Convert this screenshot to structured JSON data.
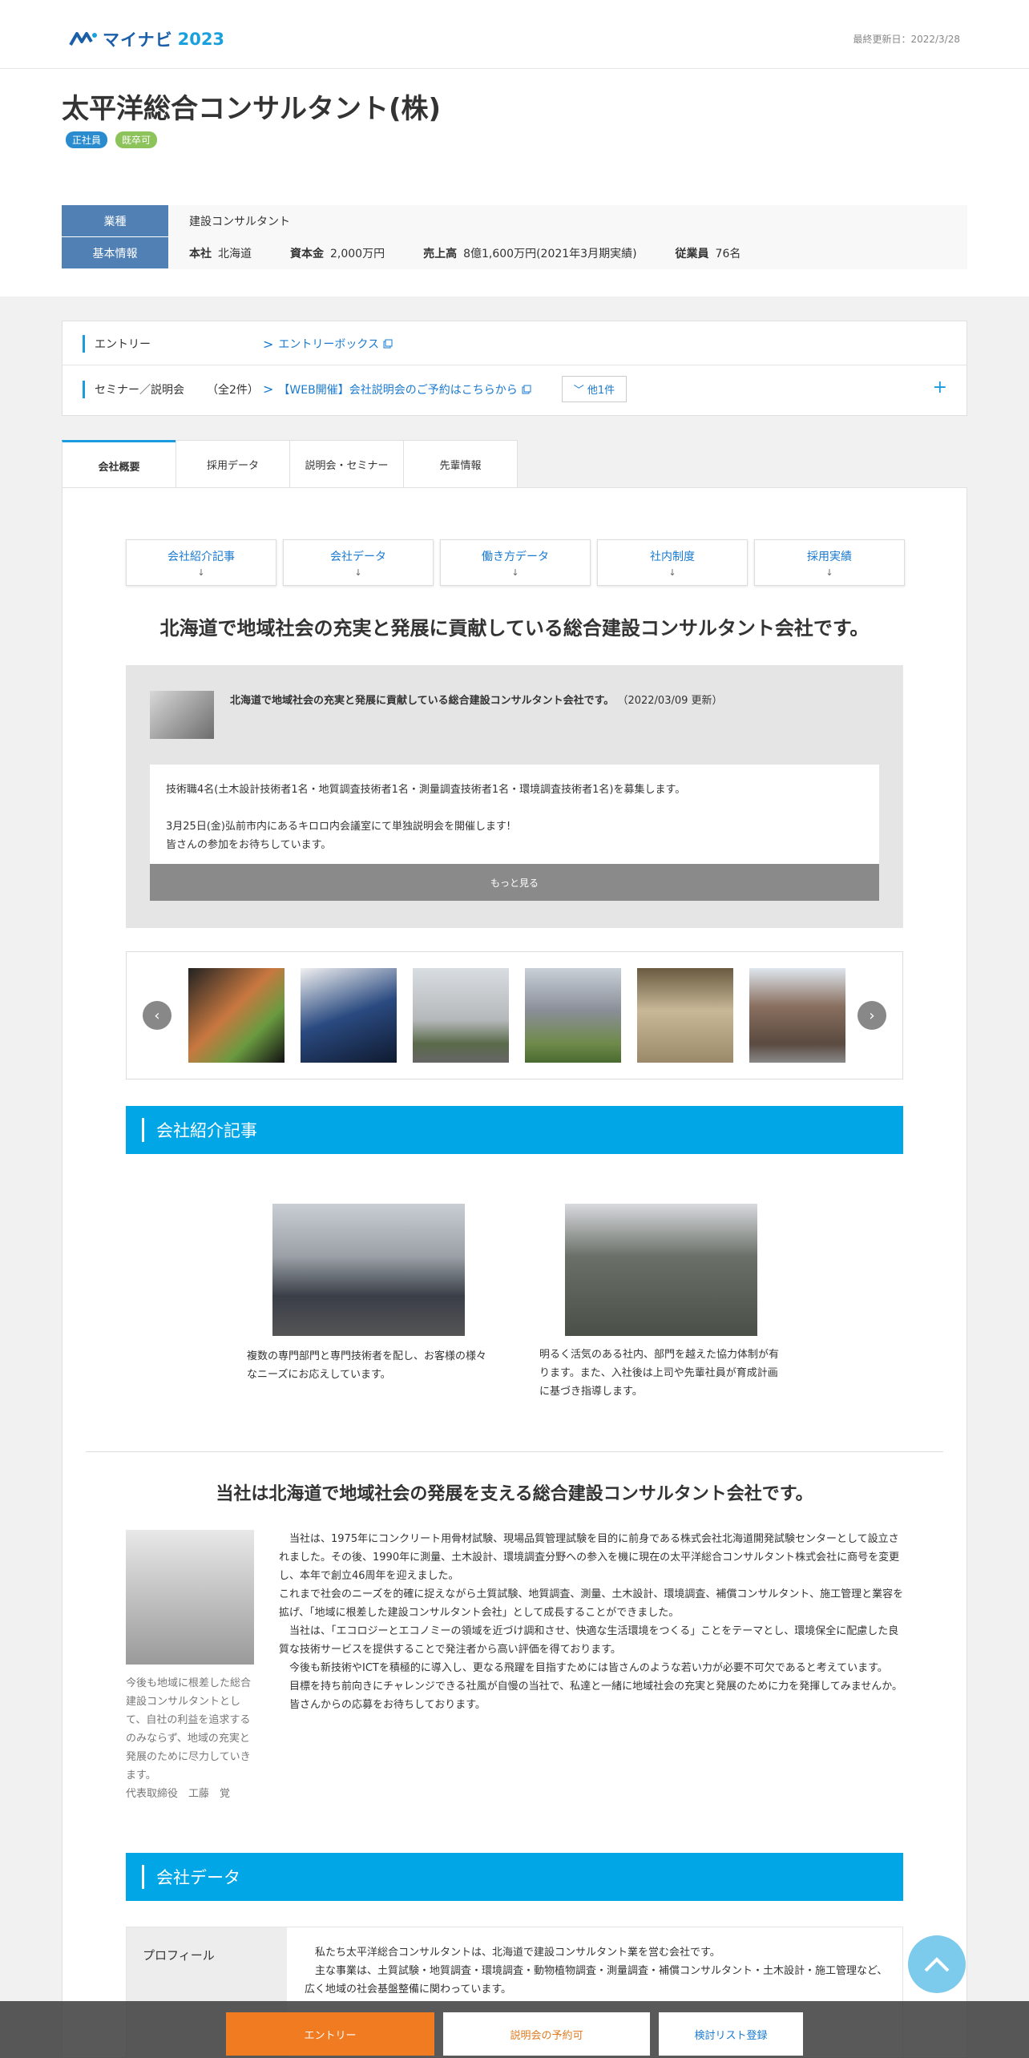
{
  "header": {
    "logo_text": "マイナビ",
    "logo_year": "2023",
    "updated": "最終更新日：2022/3/28"
  },
  "company": {
    "name": "太平洋総合コンサルタント(株)",
    "badges": [
      "正社員",
      "既卒可"
    ],
    "industry_label": "業種",
    "industry": "建設コンサルタント",
    "basic_label": "基本情報",
    "hq_label": "本社",
    "hq": "北海道",
    "capital_label": "資本金",
    "capital": "2,000万円",
    "sales_label": "売上高",
    "sales": "8億1,600万円(2021年3月期実績)",
    "employees_label": "従業員",
    "employees": "76名"
  },
  "entry": {
    "entry_label": "エントリー",
    "entry_link": "エントリーボックス",
    "seminar_label": "セミナー／説明会",
    "seminar_count": "（全2件）",
    "seminar_link": "【WEB開催】会社説明会のご予約はこちらから",
    "more": "他1件",
    "plus": "+"
  },
  "tabs": [
    "会社概要",
    "採用データ",
    "説明会・セミナー",
    "先輩情報"
  ],
  "anchors": [
    "会社紹介記事",
    "会社データ",
    "働き方データ",
    "社内制度",
    "採用実績"
  ],
  "anchor_arrow": "↓",
  "lead": "北海道で地域社会の充実と発展に貢献している総合建設コンサルタント会社です。",
  "news": {
    "title": "北海道で地域社会の充実と発展に貢献している総合建設コンサルタント会社です。",
    "date": "（2022/03/09 更新）",
    "line1": "技術職4名(土木設計技術者1名・地質調査技術者1名・測量調査技術者1名・環境調査技術者1名)を募集します。",
    "line2": "3月25日(金)弘前市内にあるキロロ内会議室にて単独説明会を開催します!",
    "line3": "皆さんの参加をお待ちしています。",
    "more": "もっと見る"
  },
  "carousel": {
    "prev": "‹",
    "next": "›"
  },
  "section1": "会社紹介記事",
  "photos": {
    "cap1": "複数の専門部門と専門技術者を配し、お客様の様々なニーズにお応えしています。",
    "cap2": "明るく活気のある社内、部門を越えた協力体制が有ります。また、入社後は上司や先輩社員が育成計画に基づき指導します。"
  },
  "lead2": "当社は北海道で地域社会の発展を支える総合建設コンサルタント会社です。",
  "president": {
    "caption": "今後も地域に根差した総合建設コンサルタントとして、自社の利益を追求するのみならず、地域の充実と発展のために尽力していきます。",
    "name": "代表取締役　工藤　覚",
    "text": "　当社は、1975年にコンクリート用骨材試験、現場品質管理試験を目的に前身である株式会社北海道開発試験センターとして設立されました。その後、1990年に測量、土木設計、環境調査分野への参入を機に現在の太平洋総合コンサルタント株式会社に商号を変更し、本年で創立46周年を迎えました。\nこれまで社会のニーズを的確に捉えながら土質試験、地質調査、測量、土木設計、環境調査、補償コンサルタント、施工管理と業容を拡げ、「地域に根差した建設コンサルタント会社」として成長することができました。\n　当社は、「エコロジーとエコノミーの領域を近づけ調和させ、快適な生活環境をつくる」ことをテーマとし、環境保全に配慮した良質な技術サービスを提供することで発注者から高い評価を得ております。\n　今後も新技術やICTを積極的に導入し、更なる飛躍を目指すためには皆さんのような若い力が必要不可欠であると考えています。\n　目標を持ち前向きにチャレンジできる社風が自慢の当社で、私達と一緒に地域社会の充実と発展のために力を発揮してみませんか。\n　皆さんからの応募をお待ちしております。"
  },
  "section2": "会社データ",
  "profile": {
    "label": "プロフィール",
    "text": "　私たち太平洋総合コンサルタントは、北海道で建設コンサルタント業を営む会社です。\n　主な事業は、土質試験・地質調査・環境調査・動物植物調査・測量調査・補償コンサルタント・土木設計・施工管理など、広く地域の社会基盤整備に関わっています。"
  },
  "bottom": {
    "entry": "エントリー",
    "seminar": "説明会の予約可",
    "list": "検討リスト登録"
  },
  "colors": {
    "accent": "#00a6e6",
    "label_blue": "#5180b4",
    "entry_orange": "#f07b20"
  }
}
